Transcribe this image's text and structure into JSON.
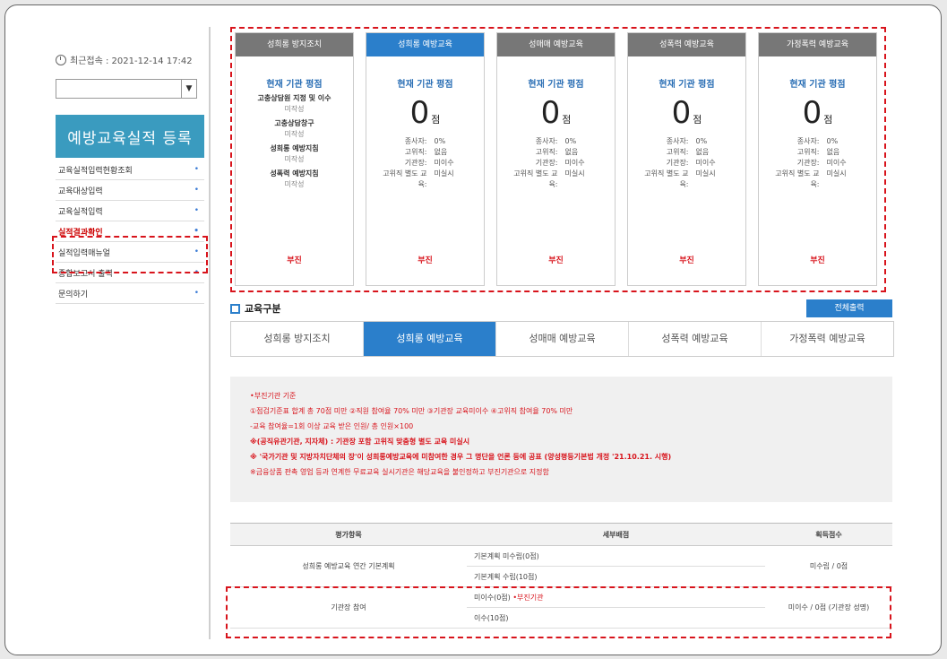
{
  "sidebar": {
    "last_login": "최근접속 : 2021-12-14 17:42",
    "banner": "예방교육실적 등록",
    "menu": [
      {
        "label": "교육실적입력현황조회"
      },
      {
        "label": "교육대상입력"
      },
      {
        "label": "교육실적입력"
      },
      {
        "label": "실적결과확인"
      },
      {
        "label": "실적입력매뉴얼"
      },
      {
        "label": "종합보고서 출력"
      },
      {
        "label": "문의하기"
      }
    ]
  },
  "cards": [
    {
      "title": "성희롱 방지조치",
      "subtitle": "현재 기관 평점",
      "items": [
        "고충상담원 지정 및 이수",
        "미작성",
        "고충상담창구",
        "미작성",
        "성희롱 예방지침",
        "미작성",
        "성폭력 예방지침",
        "미작성"
      ],
      "foot": "부진"
    },
    {
      "title": "성희롱 예방교육",
      "subtitle": "현재 기관 평점",
      "score": "0",
      "unit": "점",
      "stats": [
        [
          "종사자:",
          "0%"
        ],
        [
          "고위직:",
          "없음"
        ],
        [
          "기관장:",
          "미이수"
        ],
        [
          "고위직 별도 교육:",
          "미실시"
        ]
      ],
      "foot": "부진"
    },
    {
      "title": "성매매 예방교육",
      "subtitle": "현재 기관 평점",
      "score": "0",
      "unit": "점",
      "stats": [
        [
          "종사자:",
          "0%"
        ],
        [
          "고위직:",
          "없음"
        ],
        [
          "기관장:",
          "미이수"
        ],
        [
          "고위직 별도 교육:",
          "미실시"
        ]
      ],
      "foot": "부진"
    },
    {
      "title": "성폭력 예방교육",
      "subtitle": "현재 기관 평점",
      "score": "0",
      "unit": "점",
      "stats": [
        [
          "종사자:",
          "0%"
        ],
        [
          "고위직:",
          "없음"
        ],
        [
          "기관장:",
          "미이수"
        ],
        [
          "고위직 별도 교육:",
          "미실시"
        ]
      ],
      "foot": "부진"
    },
    {
      "title": "가정폭력 예방교육",
      "subtitle": "현재 기관 평점",
      "score": "0",
      "unit": "점",
      "stats": [
        [
          "종사자:",
          "0%"
        ],
        [
          "고위직:",
          "없음"
        ],
        [
          "기관장:",
          "미이수"
        ],
        [
          "고위직 별도 교육:",
          "미실시"
        ]
      ],
      "foot": "부진"
    }
  ],
  "section": {
    "title": "교육구분",
    "print": "전체출력"
  },
  "tabs": [
    "성희롱 방지조치",
    "성희롱 예방교육",
    "성매매 예방교육",
    "성폭력 예방교육",
    "가정폭력 예방교육"
  ],
  "notice": {
    "l1": "•부진기관 기준",
    "l2": "①점검기준표 합계 총 70점 미만  ②직원 참여율 70% 미만  ③기관장 교육미이수  ④고위직 참여율 70% 미만",
    "l3": "-교육 참여율=1회 이상 교육 받은 인원/ 총 인원×100",
    "l4": "※(공직유관기관, 지자체) : 기관장 포함 고위직 맞춤형 별도 교육 미실시",
    "l5": "※ '국가기관 및 지방자치단체의 장'이 성희롱예방교육에 미참여한 경우 그 명단을 언론 등에 공표 (양성평등기본법 개정 '21.10.21. 시행)",
    "l6": "※금융상품 판촉 영업 등과 연계한 무료교육 실시기관은 해당교육을 불인정하고 부진기관으로 지정함"
  },
  "table": {
    "headers": [
      "평가항목",
      "세부배점",
      "획득점수"
    ],
    "r1": {
      "item": "성희롱 예방교육 연간 기본계획",
      "d1": "기본계획 미수립(0점)",
      "d2": "기본계획 수립(10점)",
      "score": "미수립 / 0점"
    },
    "r2": {
      "item": "기관장 참여",
      "d1": "미이수(0점)",
      "d1tag": "•부진기관",
      "d2": "이수(10점)",
      "score": "미이수 / 0점 (기관장 성명)"
    }
  },
  "colors": {
    "accent": "#2b7fcb",
    "alert": "#d8141c",
    "banner": "#3a9bbf"
  }
}
